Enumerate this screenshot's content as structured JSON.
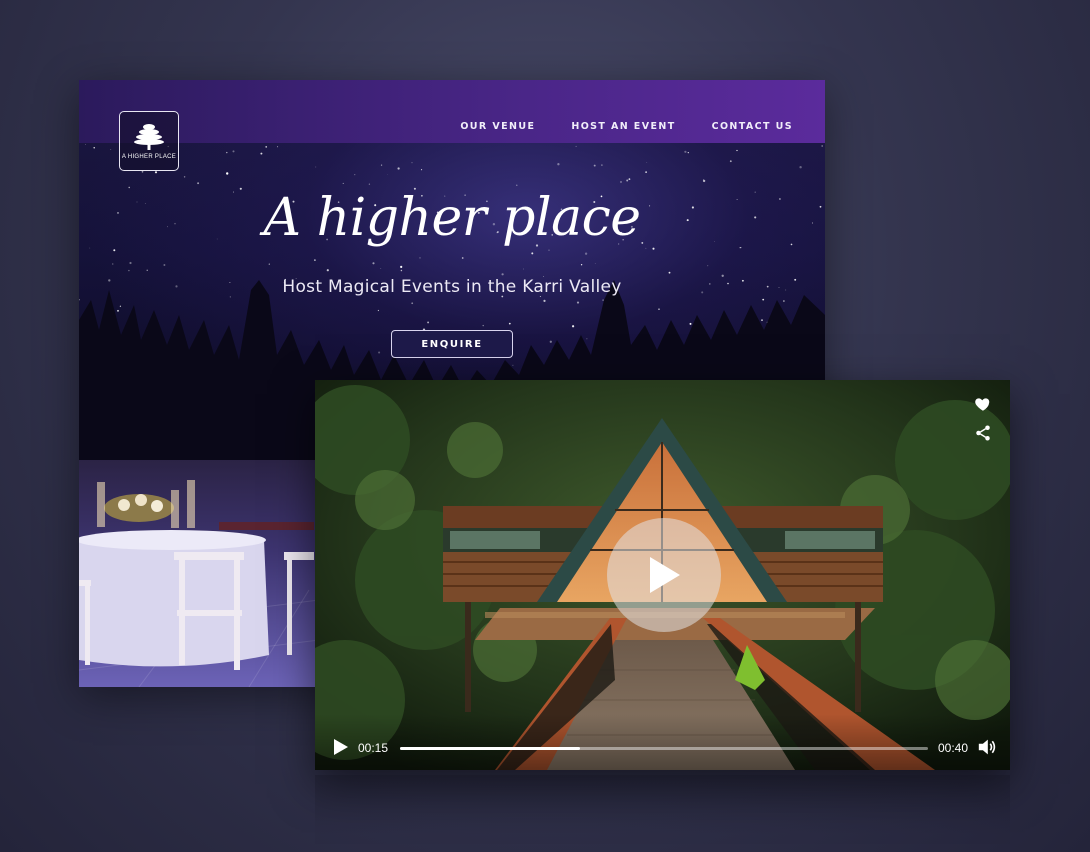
{
  "site": {
    "logo_text": "A HIGHER PLACE",
    "nav": [
      "OUR VENUE",
      "HOST AN EVENT",
      "CONTACT US"
    ],
    "hero_title": "A higher place",
    "hero_subtitle": "Host Magical Events in the Karri Valley",
    "cta_label": "ENQUIRE"
  },
  "player": {
    "current_time": "00:15",
    "duration": "00:40",
    "progress": 0.34,
    "icons": {
      "favorite": "heart-icon",
      "share": "share-icon",
      "play": "play-icon",
      "volume": "volume-icon"
    }
  },
  "colors": {
    "nav_start": "#2b1a5c",
    "nav_end": "#5b2b9c",
    "night_sky": "#15123a",
    "forest": "#1d2a17",
    "cabin_wood": "#7a4a2a"
  }
}
